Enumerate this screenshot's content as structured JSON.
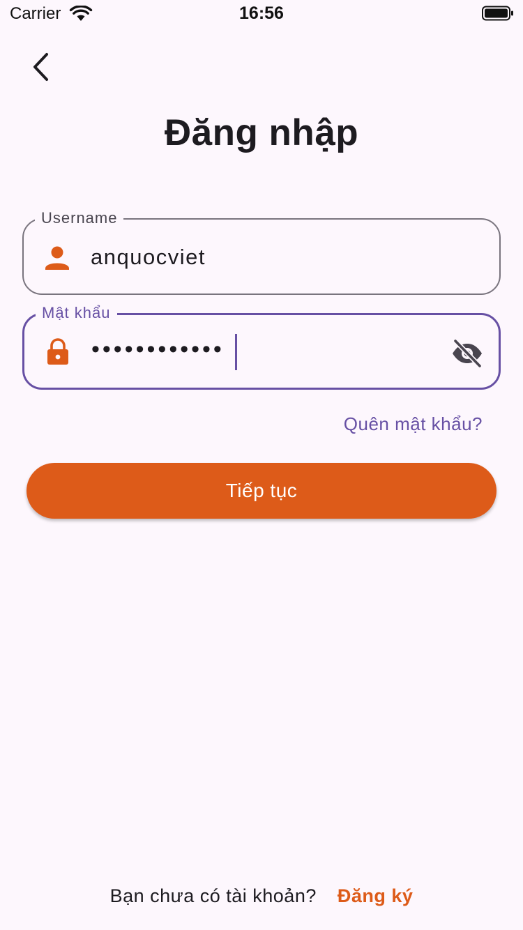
{
  "status_bar": {
    "carrier": "Carrier",
    "time": "16:56"
  },
  "header": {
    "back_icon": "chevron-left-icon",
    "title": "Đăng nhập"
  },
  "form": {
    "username": {
      "label": "Username",
      "value": "anquocviet",
      "icon": "person-icon"
    },
    "password": {
      "label": "Mật khẩu",
      "masked_value": "••••••••••••",
      "icon": "lock-icon",
      "toggle_icon": "eye-off-icon"
    },
    "forgot_password": "Quên mật khẩu?",
    "submit_label": "Tiếp tục"
  },
  "footer": {
    "prompt": "Bạn chưa có tài khoản?",
    "signup_label": "Đăng ký"
  },
  "colors": {
    "accent": "#dd5b19",
    "focus": "#6750a4",
    "background": "#fdf7fd",
    "outline": "#79747e"
  }
}
